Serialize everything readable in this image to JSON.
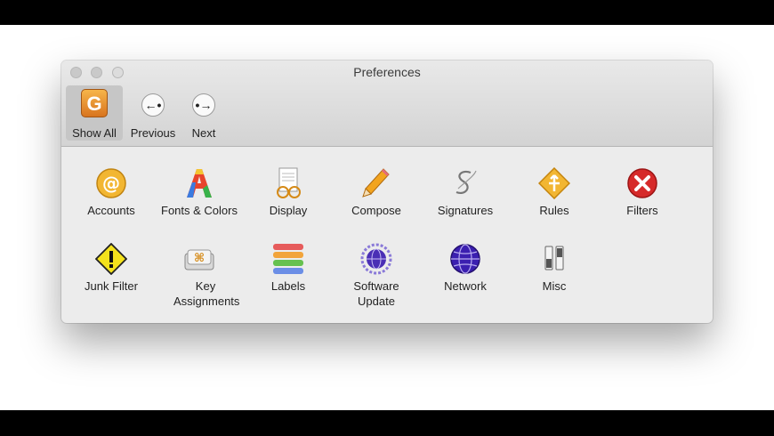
{
  "window": {
    "title": "Preferences"
  },
  "toolbar": [
    {
      "label": "Show All",
      "icon": "mail-app-icon",
      "selected": true
    },
    {
      "label": "Previous",
      "icon": "previous-arrow-icon"
    },
    {
      "label": "Next",
      "icon": "next-arrow-icon"
    }
  ],
  "toolbar_glyphs": {
    "app": "G",
    "previous": "←•",
    "next": "•→"
  },
  "panes": [
    {
      "label": "Accounts",
      "icon": "at-sign-icon"
    },
    {
      "label": "Fonts & Colors",
      "icon": "rainbow-letter-a-icon"
    },
    {
      "label": "Display",
      "icon": "document-glasses-icon"
    },
    {
      "label": "Compose",
      "icon": "pencil-icon"
    },
    {
      "label": "Signatures",
      "icon": "signature-s-icon"
    },
    {
      "label": "Rules",
      "icon": "road-sign-icon"
    },
    {
      "label": "Filters",
      "icon": "red-x-icon"
    },
    {
      "label": "Junk Filter",
      "icon": "warning-exclamation-icon"
    },
    {
      "label": "Key Assignments",
      "icon": "command-key-icon"
    },
    {
      "label": "Labels",
      "icon": "colored-labels-icon"
    },
    {
      "label": "Software Update",
      "icon": "globe-update-icon"
    },
    {
      "label": "Network",
      "icon": "network-globe-icon"
    },
    {
      "label": "Misc",
      "icon": "switches-icon"
    }
  ],
  "colors": {
    "accent_selected": "#c6c6c6",
    "window_bg": "#ececec"
  }
}
